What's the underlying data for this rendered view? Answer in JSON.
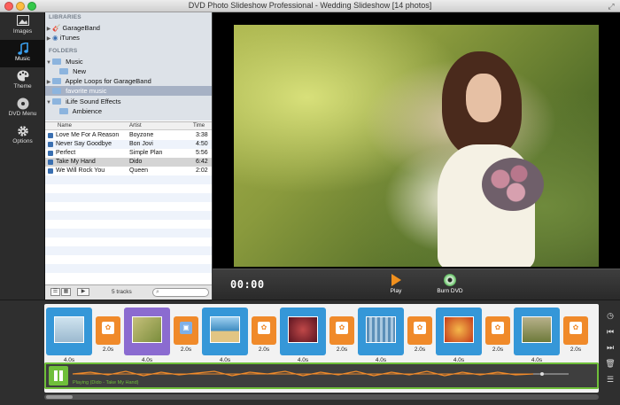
{
  "window": {
    "title": "DVD Photo Slideshow Professional - Wedding Slideshow [14 photos]"
  },
  "nav": [
    {
      "label": "Images",
      "icon": "images-icon"
    },
    {
      "label": "Music",
      "icon": "music-note-icon"
    },
    {
      "label": "Theme",
      "icon": "palette-icon"
    },
    {
      "label": "DVD Menu",
      "icon": "disc-icon"
    },
    {
      "label": "Options",
      "icon": "gear-icon"
    }
  ],
  "browser": {
    "libraries_header": "LIBRARIES",
    "libraries": [
      "GarageBand",
      "iTunes"
    ],
    "folders_header": "FOLDERS",
    "folders": [
      {
        "label": "Music",
        "level": 0
      },
      {
        "label": "New",
        "level": 1
      },
      {
        "label": "Apple Loops for GarageBand",
        "level": 0
      },
      {
        "label": "favorite music",
        "level": 0,
        "selected": true
      },
      {
        "label": "iLife Sound Effects",
        "level": 0
      },
      {
        "label": "Ambience",
        "level": 1
      }
    ],
    "columns": {
      "name": "Name",
      "artist": "Artist",
      "time": "Time"
    },
    "tracks": [
      {
        "name": "Love Me For A Reason",
        "artist": "Boyzone",
        "time": "3:38"
      },
      {
        "name": "Never Say Goodbye",
        "artist": "Bon Jovi",
        "time": "4:50"
      },
      {
        "name": "Perfect",
        "artist": "Simple Plan",
        "time": "5:56"
      },
      {
        "name": "Take My Hand",
        "artist": "Dido",
        "time": "6:42"
      },
      {
        "name": "We Will Rock You",
        "artist": "Queen",
        "time": "2:02"
      }
    ],
    "track_count": "5 tracks"
  },
  "controls": {
    "timecode": "00:00",
    "play_label": "Play",
    "burn_label": "Burn DVD"
  },
  "timeline": {
    "slides": [
      "4.0s",
      "4.0s",
      "4.0s",
      "4.0s",
      "4.0s",
      "4.0s",
      "4.0s"
    ],
    "transitions": [
      "2.0s",
      "2.0s",
      "2.0s",
      "2.0s",
      "2.0s",
      "2.0s",
      "2.0s"
    ],
    "audio_label": "Playing (Dido - Take My Hand)"
  },
  "colors": {
    "accent": "#3597d8",
    "selected_slide": "#8b6bd0",
    "transition": "#f08a2a",
    "audio": "#6fbf3a",
    "play": "#f0901e"
  }
}
